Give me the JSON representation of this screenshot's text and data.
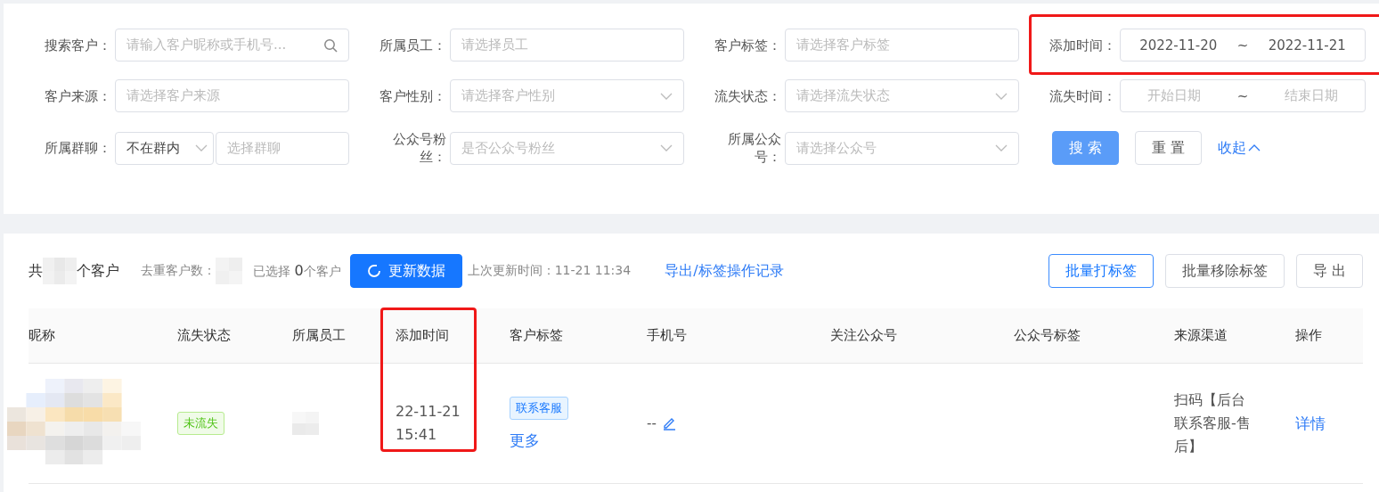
{
  "filters": [
    {
      "label": "搜索客户：",
      "kind": "search",
      "placeholder": "请输入客户昵称或手机号..."
    },
    {
      "label": "所属员工：",
      "kind": "input",
      "placeholder": "请选择员工"
    },
    {
      "label": "客户标签：",
      "kind": "input",
      "placeholder": "请选择客户标签"
    },
    {
      "label": "添加时间：",
      "kind": "daterange",
      "start": "2022-11-20",
      "separator": "~",
      "end": "2022-11-21",
      "highlighted": true
    },
    {
      "label": "客户来源：",
      "kind": "input",
      "placeholder": "请选择客户来源"
    },
    {
      "label": "客户性别：",
      "kind": "select",
      "placeholder": "请选择客户性别"
    },
    {
      "label": "流失状态：",
      "kind": "select",
      "placeholder": "请选择流失状态"
    },
    {
      "label": "流失时间：",
      "kind": "daterange",
      "start_placeholder": "开始日期",
      "separator": "~",
      "end_placeholder": "结束日期",
      "highlighted": false
    },
    {
      "label": "所属群聊：",
      "kind": "group",
      "value": "不在群内",
      "placeholder": "选择群聊"
    },
    {
      "label": "公众号粉丝：",
      "kind": "select",
      "placeholder": "是否公众号粉丝"
    },
    {
      "label": "所属公众号：",
      "kind": "select",
      "placeholder": "请选择公众号"
    }
  ],
  "filter_actions": {
    "search": "搜 索",
    "reset": "重 置",
    "collapse": "收起"
  },
  "toolbar": {
    "total_prefix": "共",
    "total_suffix": "个客户",
    "dedup_label": "去重客户数：",
    "selected_prefix": "已选择",
    "selected_count": "0",
    "selected_suffix": "个客户",
    "refresh": "更新数据",
    "last_update": "上次更新时间：11-21 11:34",
    "log_link": "导出/标签操作记录",
    "buttons": [
      {
        "label": "批量打标签",
        "kind": "outline"
      },
      {
        "label": "批量移除标签",
        "kind": "default"
      },
      {
        "label": "导 出",
        "kind": "default"
      }
    ]
  },
  "table": {
    "columns": [
      {
        "label": "昵称",
        "highlighted": false
      },
      {
        "label": "流失状态",
        "highlighted": false
      },
      {
        "label": "所属员工",
        "highlighted": false
      },
      {
        "label": "添加时间",
        "highlighted": true
      },
      {
        "label": "客户标签",
        "highlighted": false
      },
      {
        "label": "手机号",
        "highlighted": false
      },
      {
        "label": "关注公众号",
        "highlighted": false
      },
      {
        "label": "公众号标签",
        "highlighted": false
      },
      {
        "label": "来源渠道",
        "highlighted": false
      },
      {
        "label": "操作",
        "highlighted": false
      }
    ],
    "rows": [
      {
        "status": "未流失",
        "added": "22-11-21 15:41",
        "tag": "联系客服",
        "more": "更多",
        "phone": "--",
        "source": "扫码【后台联系客服-售后】",
        "action": "详情"
      }
    ]
  }
}
